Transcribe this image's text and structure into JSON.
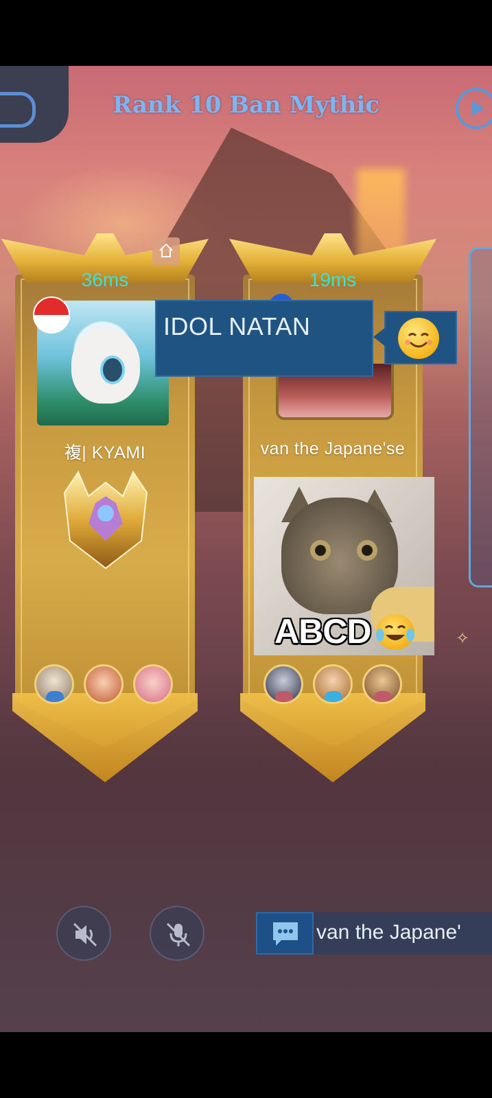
{
  "header": {
    "title": "Rank 10 Ban Mythic"
  },
  "players": [
    {
      "ping": "36ms",
      "name": "複| KYAMI",
      "flag": "indonesia-flag",
      "heroes": [
        "hero-goggles",
        "hero-redhair",
        "hero-pinkhair"
      ]
    },
    {
      "ping": "19ms",
      "name": "van the Japane'se",
      "heroes": [
        "hero-dark",
        "hero-blonde",
        "hero-helmet"
      ]
    }
  ],
  "chat_bubble": {
    "text": "IDOL NATAN",
    "emoji": "smiling-face-emoji"
  },
  "sticker": {
    "caption": "ABCD",
    "emoji": "tears-of-joy-emoji"
  },
  "bottom_bar": {
    "chat_preview": "van the Japane'"
  },
  "colors": {
    "title": "#7fb4ee",
    "ping": "#3ee0d6",
    "chat_bg": "#1e5382",
    "banner_gold": "#d8ab4a"
  }
}
